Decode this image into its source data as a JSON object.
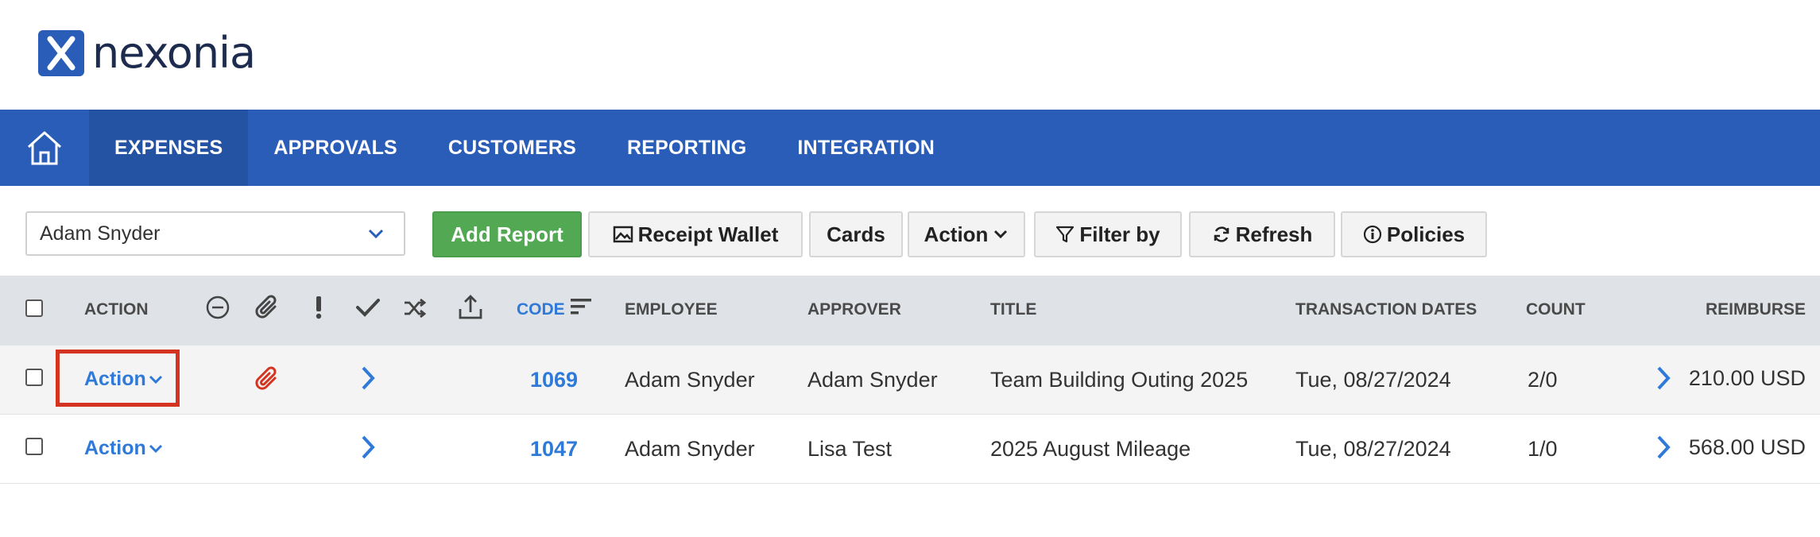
{
  "brand": {
    "name": "nexonia",
    "colors": {
      "primary": "#2a5db8",
      "add_button": "#52a853",
      "link": "#2f7ad9",
      "highlight": "#d4331f"
    }
  },
  "nav": {
    "items": [
      {
        "label": "EXPENSES",
        "active": true
      },
      {
        "label": "APPROVALS",
        "active": false
      },
      {
        "label": "CUSTOMERS",
        "active": false
      },
      {
        "label": "REPORTING",
        "active": false
      },
      {
        "label": "INTEGRATION",
        "active": false
      }
    ]
  },
  "toolbar": {
    "employee_selected": "Adam Snyder",
    "add_report": "Add Report",
    "receipt_wallet": "Receipt Wallet",
    "cards": "Cards",
    "action": "Action",
    "filter_by": "Filter by",
    "refresh": "Refresh",
    "policies": "Policies"
  },
  "table": {
    "headers": {
      "action": "ACTION",
      "code": "CODE",
      "employee": "EMPLOYEE",
      "approver": "APPROVER",
      "title": "TITLE",
      "transaction_dates": "TRANSACTION DATES",
      "count": "COUNT",
      "reimburse": "REIMBURSE"
    },
    "icon_columns": [
      "remove-circle-icon",
      "paperclip-icon",
      "exclamation-icon",
      "checkmark-icon",
      "shuffle-icon",
      "export-icon"
    ],
    "rows": [
      {
        "action": "Action",
        "has_attachment": true,
        "code": "1069",
        "employee": "Adam Snyder",
        "approver": "Adam Snyder",
        "title": "Team Building Outing 2025",
        "transaction_dates": "Tue, 08/27/2024",
        "count": "2/0",
        "reimburse": "210.00 USD"
      },
      {
        "action": "Action",
        "has_attachment": false,
        "code": "1047",
        "employee": "Adam Snyder",
        "approver": "Lisa Test",
        "title": "2025 August Mileage",
        "transaction_dates": "Tue, 08/27/2024",
        "count": "1/0",
        "reimburse": "568.00 USD"
      }
    ]
  }
}
